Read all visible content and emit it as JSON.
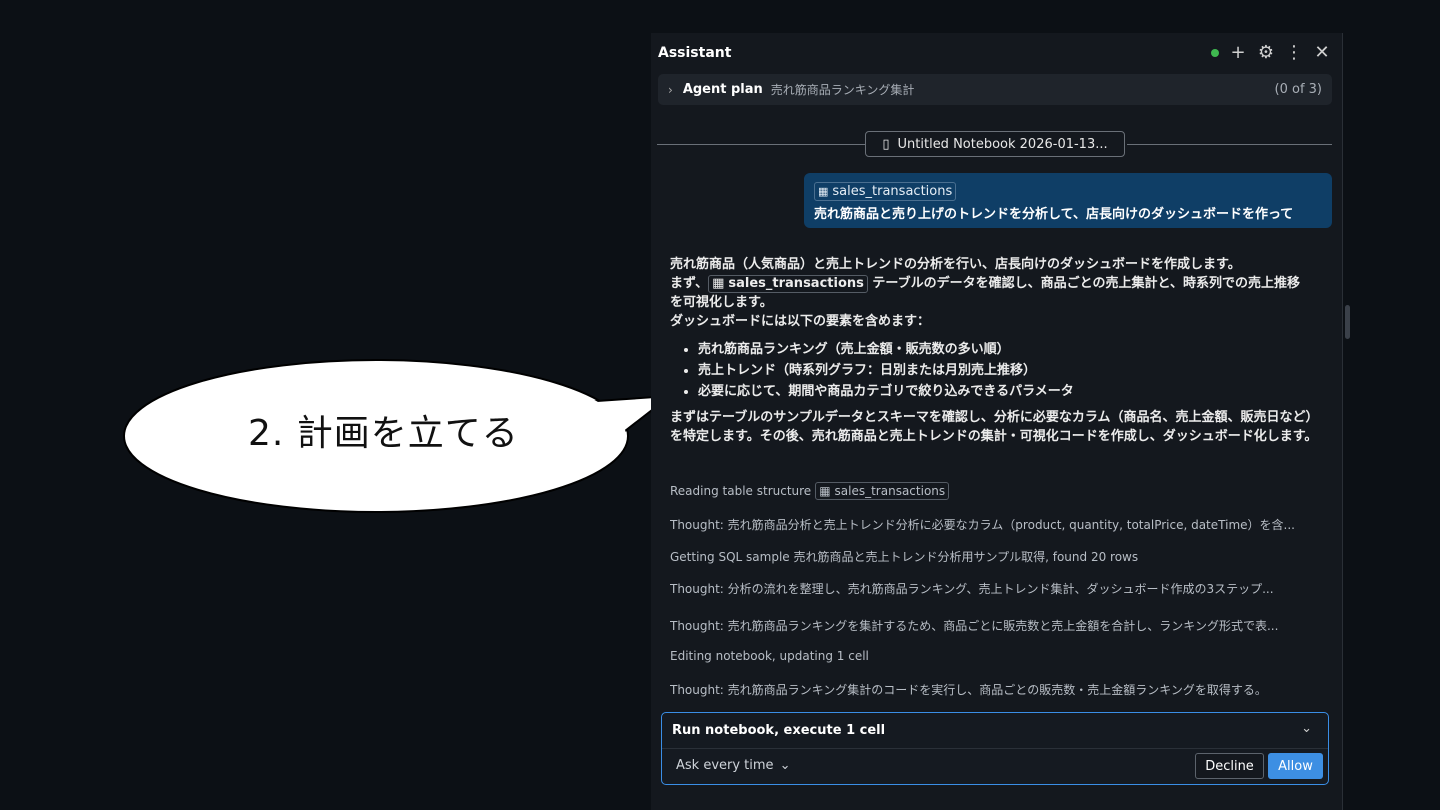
{
  "callout": {
    "text": "2. 計画を立てる"
  },
  "header": {
    "title": "Assistant",
    "status_color": "#3fb950"
  },
  "plan": {
    "label": "Agent plan",
    "subtitle": "売れ筋商品ランキング集計",
    "count": "(0 of 3)"
  },
  "notebook": {
    "name": "Untitled Notebook 2026-01-13..."
  },
  "user_message": {
    "table_chip": "sales_transactions",
    "text": "売れ筋商品と売り上げのトレンドを分析して、店長向けのダッシュボードを作って"
  },
  "reply": {
    "line1": "売れ筋商品（人気商品）と売上トレンドの分析を行い、店長向けのダッシュボードを作成します。",
    "line2_prefix": "まず、",
    "line2_chip": "sales_transactions",
    "line2_suffix": "テーブルのデータを確認し、商品ごとの売上集計と、時系列での売上推移",
    "line3": "を可視化します。",
    "line4": "ダッシュボードには以下の要素を含めます：",
    "bullets": [
      "売れ筋商品ランキング（売上金額・販売数の多い順）",
      "売上トレンド（時系列グラフ：日別または月別売上推移）",
      "必要に応じて、期間や商品カテゴリで絞り込みできるパラメータ"
    ],
    "para2": "まずはテーブルのサンプルデータとスキーマを確認し、分析に必要なカラム（商品名、売上金額、販売日など）を特定します。その後、売れ筋商品と売上トレンドの集計・可視化コードを作成し、ダッシュボード化します。"
  },
  "logs": [
    {
      "text": "Reading table structure",
      "chip": "sales_transactions"
    },
    {
      "text": "Thought: 売れ筋商品分析と売上トレンド分析に必要なカラム（product, quantity, totalPrice, dateTime）を含..."
    },
    {
      "text": "Getting SQL sample 売れ筋商品と売上トレンド分析用サンプル取得, found 20 rows"
    },
    {
      "text": "Thought: 分析の流れを整理し、売れ筋商品ランキング、売上トレンド集計、ダッシュボード作成の3ステップ..."
    },
    {
      "text": "Thought: 売れ筋商品ランキングを集計するため、商品ごとに販売数と売上金額を合計し、ランキング形式で表..."
    },
    {
      "text": "Editing notebook, updating 1 cell"
    },
    {
      "text": "Thought: 売れ筋商品ランキング集計のコードを実行し、商品ごとの販売数・売上金額ランキングを取得する。"
    }
  ],
  "approval": {
    "title": "Run notebook, execute 1 cell",
    "ask_label": "Ask every time",
    "decline_label": "Decline",
    "allow_label": "Allow",
    "accent_color": "#3d8fe3"
  }
}
